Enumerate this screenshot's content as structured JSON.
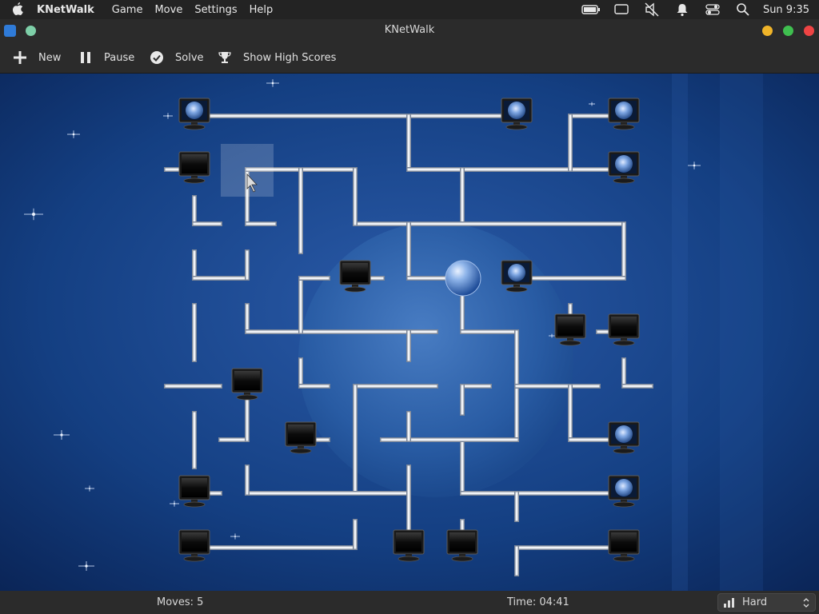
{
  "menubar": {
    "app_name": "KNetWalk",
    "menus": [
      "Game",
      "Move",
      "Settings",
      "Help"
    ],
    "clock": "Sun 9:35",
    "tray_icons": [
      "battery-icon",
      "screen-mirror-icon",
      "muted-speaker-icon",
      "notification-bell-icon",
      "control-center-icon",
      "search-icon"
    ]
  },
  "window": {
    "title": "KNetWalk"
  },
  "toolbar": {
    "new_label": "New",
    "pause_label": "Pause",
    "solve_label": "Solve",
    "highscores_label": "Show High Scores"
  },
  "status": {
    "moves": "Moves: 5",
    "time": "Time: 04:41",
    "difficulty": "Hard"
  },
  "colors": {
    "accent_yellow": "#f0b429",
    "accent_green": "#3fbf4f",
    "accent_red": "#ef4444",
    "board_blue": "#0d2f6b"
  }
}
